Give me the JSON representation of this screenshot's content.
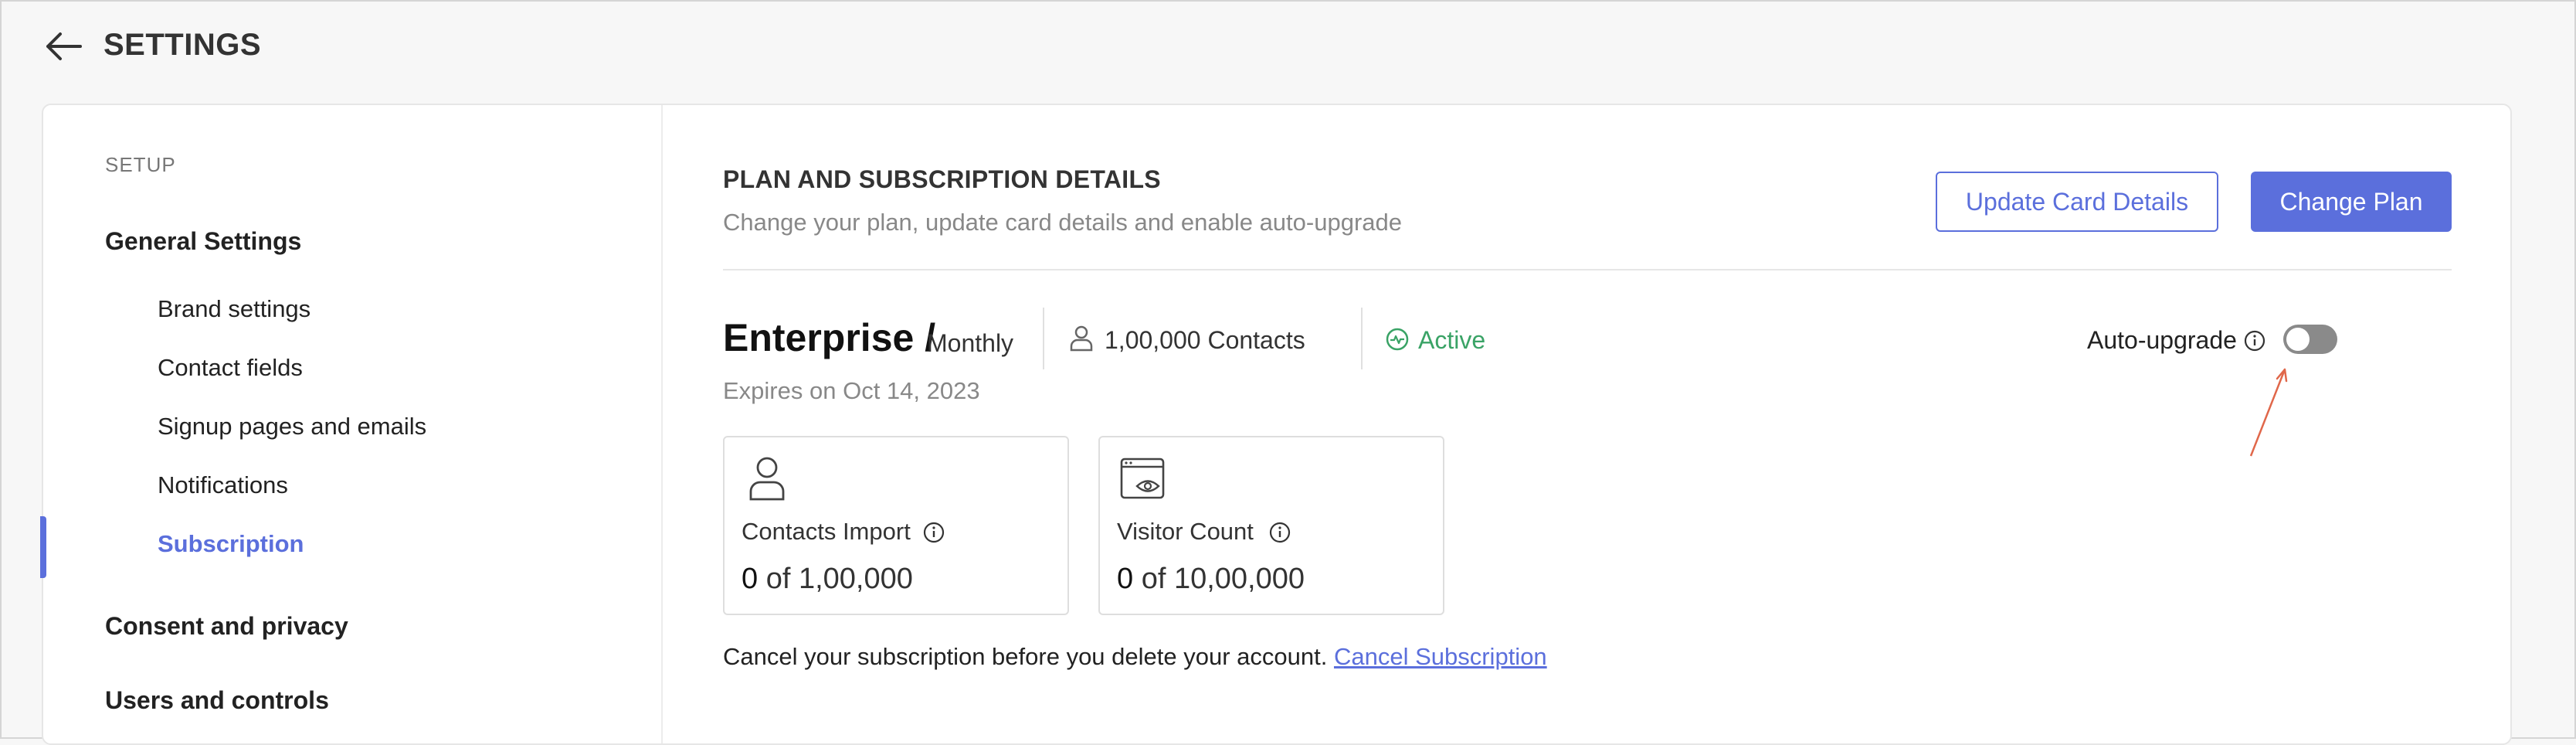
{
  "header": {
    "title": "SETTINGS",
    "back_icon": "arrow-left-icon"
  },
  "sidebar": {
    "section_label": "SETUP",
    "groups": [
      {
        "label": "General Settings",
        "items": [
          {
            "label": "Brand settings"
          },
          {
            "label": "Contact fields"
          },
          {
            "label": "Signup pages and emails"
          },
          {
            "label": "Notifications"
          },
          {
            "label": "Subscription",
            "active": true
          }
        ]
      },
      {
        "label": "Consent and privacy"
      },
      {
        "label": "Users and controls"
      }
    ]
  },
  "main": {
    "title": "PLAN AND SUBSCRIPTION DETAILS",
    "subtitle": "Change your plan, update card details and enable auto-upgrade",
    "update_card_label": "Update Card Details",
    "change_plan_label": "Change Plan",
    "plan": {
      "name": "Enterprise /",
      "cycle": "Monthly",
      "contacts": "1,00,000 Contacts",
      "status": "Active",
      "expires": "Expires on Oct 14, 2023"
    },
    "auto_upgrade": {
      "label": "Auto-upgrade",
      "enabled": false
    },
    "stats": [
      {
        "title": "Contacts Import",
        "used": "0",
        "of_text": " of 1,00,000",
        "icon": "user-icon"
      },
      {
        "title": "Visitor Count",
        "used": "0",
        "of_text": " of 10,00,000",
        "icon": "browser-eye-icon"
      }
    ],
    "cancel": {
      "note": "Cancel your subscription before you delete your account.",
      "link": "Cancel Subscription"
    }
  },
  "colors": {
    "accent": "#5b6fdc",
    "active_status": "#3aa366",
    "annotation_arrow": "#e0674a"
  }
}
